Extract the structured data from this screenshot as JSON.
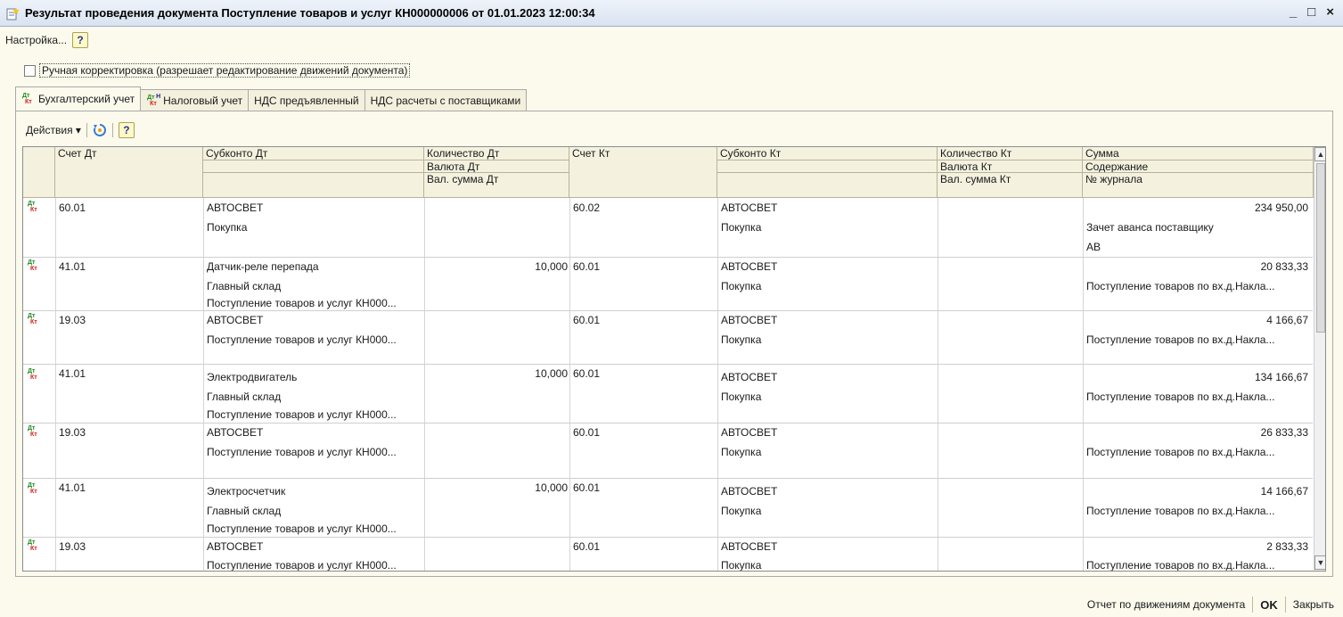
{
  "window": {
    "title": "Результат проведения документа Поступление товаров и услуг КН000000006 от 01.01.2023 12:00:34",
    "minimize": "_",
    "maximize": "□",
    "close": "×"
  },
  "menu": {
    "settings": "Настройка...",
    "help": "?"
  },
  "manual_edit": {
    "label": "Ручная корректировка (разрешает редактирование движений документа)",
    "checked": false
  },
  "tabs": [
    {
      "label": "Бухгалтерский учет",
      "icon": "dt-kt-icon",
      "active": true
    },
    {
      "label": "Налоговый учет",
      "icon": "dt-kt-n-icon",
      "active": false
    },
    {
      "label": "НДС предъявленный",
      "active": false
    },
    {
      "label": "НДС расчеты с поставщиками",
      "active": false
    }
  ],
  "toolbar": {
    "actions": "Действия ▾",
    "help": "?"
  },
  "columns": {
    "schet_dt": "Счет Дт",
    "subkonto_dt": "Субконто Дт",
    "kol_dt": "Количество Дт",
    "valuta_dt": "Валюта Дт",
    "valsum_dt": "Вал. сумма Дт",
    "schet_kt": "Счет Кт",
    "subkonto_kt": "Субконто Кт",
    "kol_kt": "Количество Кт",
    "valuta_kt": "Валюта Кт",
    "valsum_kt": "Вал. сумма Кт",
    "summa": "Сумма",
    "soderzhanie": "Содержание",
    "nomer_zhurnala": "№ журнала"
  },
  "rows": [
    {
      "schet_dt": "60.01",
      "sub_dt": [
        "АВТОСВЕТ",
        "Покупка",
        ""
      ],
      "kol_dt": "",
      "schet_kt": "60.02",
      "sub_kt": [
        "АВТОСВЕТ",
        "Покупка"
      ],
      "summa": "234 950,00",
      "soderzhanie": "Зачет аванса поставщику",
      "zhurnal": "АВ"
    },
    {
      "schet_dt": "41.01",
      "sub_dt": [
        "Датчик-реле перепада",
        "Главный склад",
        "Поступление товаров и услуг КН000..."
      ],
      "kol_dt": "10,000",
      "schet_kt": "60.01",
      "sub_kt": [
        "АВТОСВЕТ",
        "Покупка"
      ],
      "summa": "20 833,33",
      "soderzhanie": "Поступление товаров по вх.д.Накла...",
      "zhurnal": ""
    },
    {
      "schet_dt": "19.03",
      "sub_dt": [
        "АВТОСВЕТ",
        "Поступление товаров и услуг КН000...",
        ""
      ],
      "kol_dt": "",
      "schet_kt": "60.01",
      "sub_kt": [
        "АВТОСВЕТ",
        "Покупка"
      ],
      "summa": "4 166,67",
      "soderzhanie": "Поступление товаров по вх.д.Накла...",
      "zhurnal": ""
    },
    {
      "schet_dt": "41.01",
      "sub_dt": [
        "Электродвигатель",
        "Главный склад",
        "Поступление товаров и услуг КН000..."
      ],
      "kol_dt": "10,000",
      "schet_kt": "60.01",
      "sub_kt": [
        "АВТОСВЕТ",
        "Покупка"
      ],
      "summa": "134 166,67",
      "soderzhanie": "Поступление товаров по вх.д.Накла...",
      "zhurnal": ""
    },
    {
      "schet_dt": "19.03",
      "sub_dt": [
        "АВТОСВЕТ",
        "Поступление товаров и услуг КН000...",
        ""
      ],
      "kol_dt": "",
      "schet_kt": "60.01",
      "sub_kt": [
        "АВТОСВЕТ",
        "Покупка"
      ],
      "summa": "26 833,33",
      "soderzhanie": "Поступление товаров по вх.д.Накла...",
      "zhurnal": ""
    },
    {
      "schet_dt": "41.01",
      "sub_dt": [
        "Электросчетчик",
        "Главный склад",
        "Поступление товаров и услуг КН000..."
      ],
      "kol_dt": "10,000",
      "schet_kt": "60.01",
      "sub_kt": [
        "АВТОСВЕТ",
        "Покупка"
      ],
      "summa": "14 166,67",
      "soderzhanie": "Поступление товаров по вх.д.Накла...",
      "zhurnal": ""
    },
    {
      "schet_dt": "19.03",
      "sub_dt": [
        "АВТОСВЕТ",
        "Поступление товаров и услуг КН000...",
        ""
      ],
      "kol_dt": "",
      "schet_kt": "60.01",
      "sub_kt": [
        "АВТОСВЕТ",
        "Покупка"
      ],
      "summa": "2 833,33",
      "soderzhanie": "Поступление товаров по вх.д.Накла...",
      "zhurnal": ""
    }
  ],
  "row_icon": {
    "dt": "Дт",
    "kt": "Кт"
  },
  "footer": {
    "report": "Отчет по движениям документа",
    "ok": "OK",
    "close": "Закрыть"
  },
  "colors": {
    "background": "#fbfaed",
    "header": "#f4f2df",
    "dt_green": "#1c8a1c",
    "kt_red": "#d21c1c"
  }
}
